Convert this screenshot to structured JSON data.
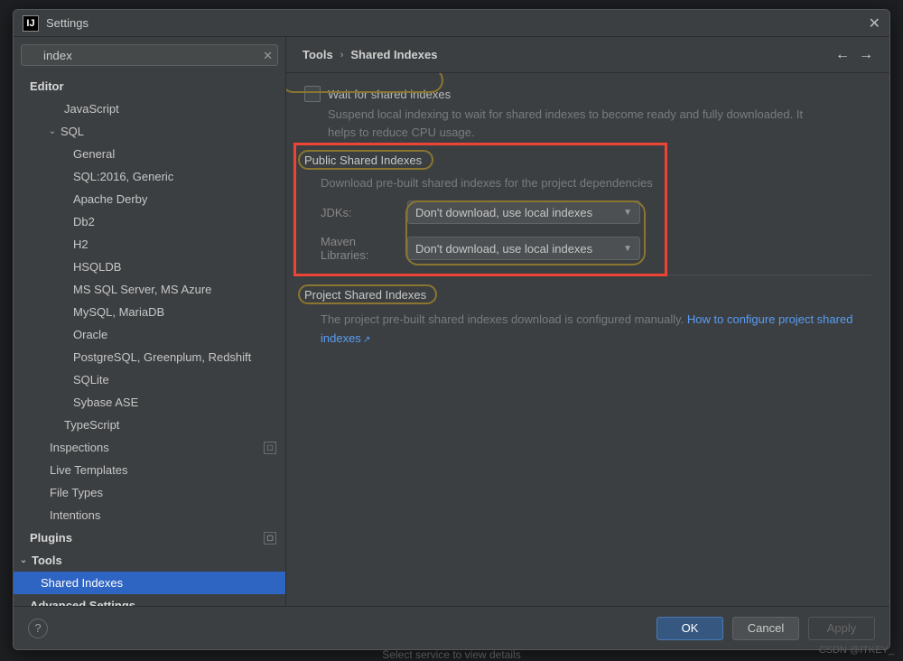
{
  "window": {
    "title": "Settings"
  },
  "search": {
    "value": "index"
  },
  "tree": {
    "editor": "Editor",
    "javascript": "JavaScript",
    "sql": "SQL",
    "sql_items": [
      "General",
      "SQL:2016, Generic",
      "Apache Derby",
      "Db2",
      "H2",
      "HSQLDB",
      "MS SQL Server, MS Azure",
      "MySQL, MariaDB",
      "Oracle",
      "PostgreSQL, Greenplum, Redshift",
      "SQLite",
      "Sybase ASE"
    ],
    "typescript": "TypeScript",
    "inspections": "Inspections",
    "live_templates": "Live Templates",
    "file_types": "File Types",
    "intentions": "Intentions",
    "plugins": "Plugins",
    "tools": "Tools",
    "shared_indexes": "Shared Indexes",
    "advanced": "Advanced Settings"
  },
  "breadcrumb": {
    "tools": "Tools",
    "shared": "Shared Indexes"
  },
  "panel": {
    "wait_label": "Wait for shared indexes",
    "wait_desc": "Suspend local indexing to wait for shared indexes to become ready and fully downloaded. It helps to reduce CPU usage.",
    "public_title": "Public Shared Indexes",
    "public_desc": "Download pre-built shared indexes for the project dependencies",
    "jdks_label": "JDKs:",
    "maven_label": "Maven Libraries:",
    "dropdown_value": "Don't download, use local indexes",
    "project_title": "Project Shared Indexes",
    "project_desc": "The project pre-built shared indexes download is configured manually. ",
    "project_link": "How to configure project shared indexes"
  },
  "footer": {
    "ok": "OK",
    "cancel": "Cancel",
    "apply": "Apply"
  },
  "status": "Select service to view details",
  "watermark": "CSDN @ITKEY_"
}
